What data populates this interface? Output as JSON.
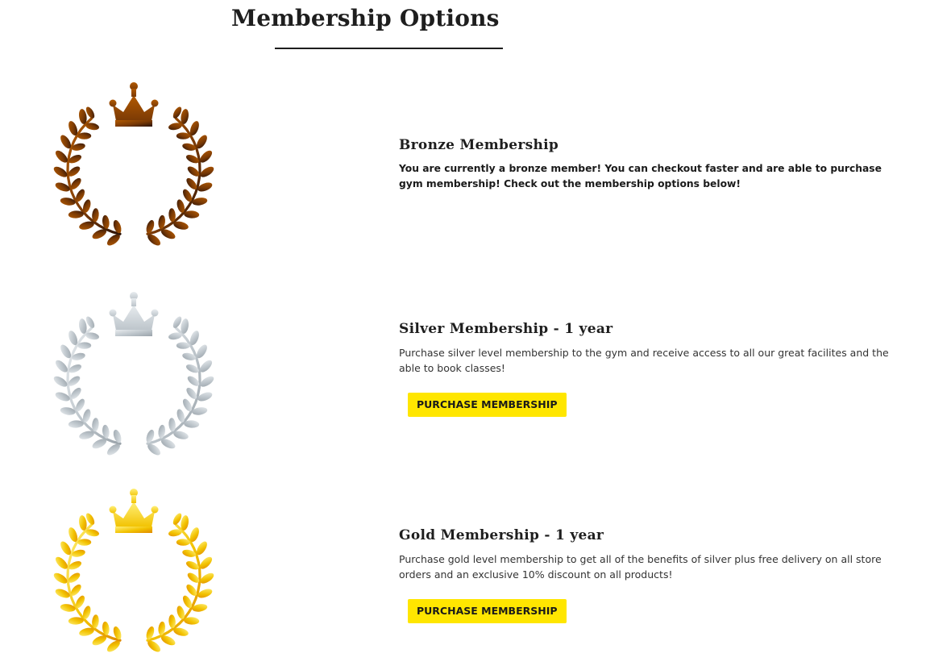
{
  "page": {
    "title": "Membership Options"
  },
  "tiers": [
    {
      "id": "bronze",
      "heading": "Bronze Membership",
      "description": "You are currently a bronze member! You can checkout faster and are able to purchase gym membership! Check out the membership options below!",
      "emblem_icon": "bronze-laurel-crown-icon",
      "colors": {
        "light": "#b35a00",
        "mid": "#7a3a05",
        "dark": "#2a1206"
      }
    },
    {
      "id": "silver",
      "heading": "Silver Membership - 1 year",
      "description": "Purchase silver level membership to the gym and receive access to all our great facilites and the able to book classes!",
      "button_label": "PURCHASE MEMBERSHIP",
      "emblem_icon": "silver-laurel-crown-icon",
      "colors": {
        "light": "#e8ecef",
        "mid": "#bcc4ca",
        "dark": "#9aa3aa"
      }
    },
    {
      "id": "gold",
      "heading": "Gold Membership - 1 year",
      "description": "Purchase gold level membership to get all of the benefits of silver plus free delivery on all store orders and an exclusive 10% discount on all products!",
      "button_label": "PURCHASE MEMBERSHIP",
      "emblem_icon": "gold-laurel-crown-icon",
      "colors": {
        "light": "#fff07a",
        "mid": "#f2c200",
        "dark": "#e08a00"
      }
    }
  ],
  "theme": {
    "button_background": "#ffe600",
    "text_dark": "#1e1e1e"
  }
}
